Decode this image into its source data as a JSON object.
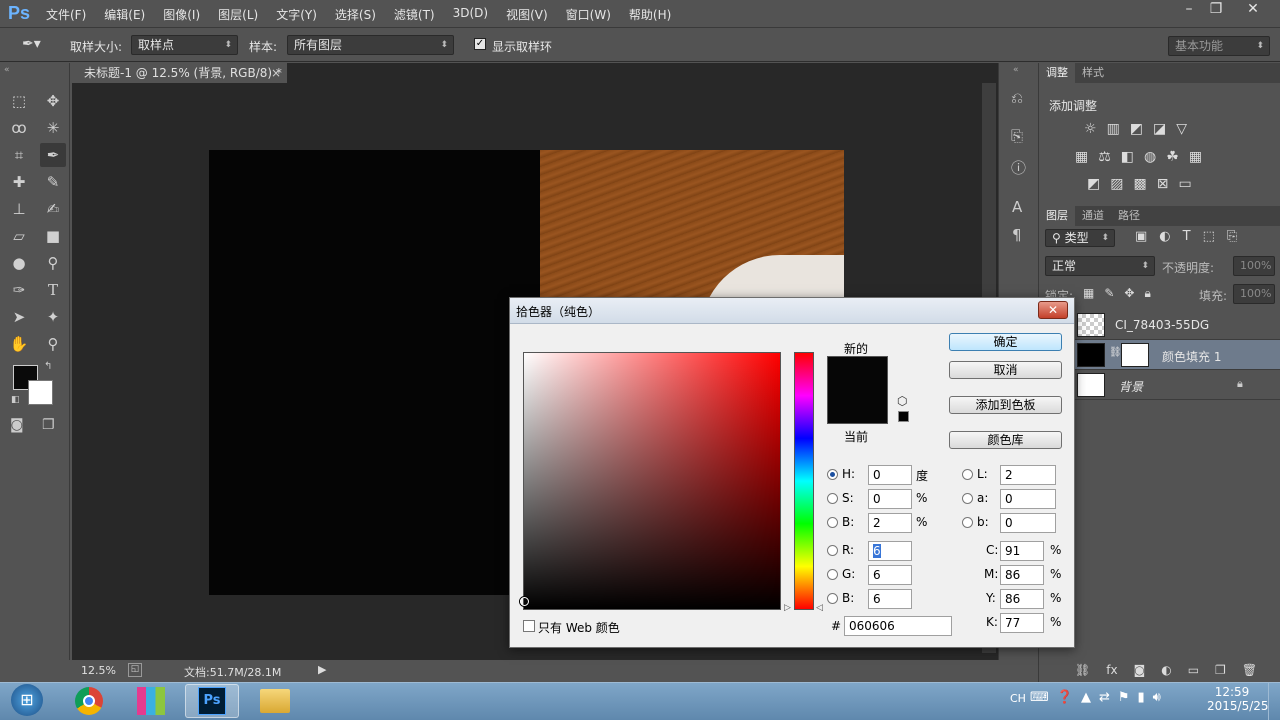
{
  "app": {
    "logo": "Ps"
  },
  "menu": [
    "文件(F)",
    "编辑(E)",
    "图像(I)",
    "图层(L)",
    "文字(Y)",
    "选择(S)",
    "滤镜(T)",
    "3D(D)",
    "视图(V)",
    "窗口(W)",
    "帮助(H)"
  ],
  "options": {
    "sample_size_label": "取样大小:",
    "sample_size_value": "取样点",
    "sample_label": "样本:",
    "sample_value": "所有图层",
    "show_ring_label": "显示取样环",
    "workspace": "基本功能"
  },
  "document": {
    "tab_title": "未标题-1 @ 12.5% (背景, RGB/8) *",
    "zoom": "12.5%",
    "doc_info": "文档:51.7M/28.1M"
  },
  "adjust_panel": {
    "tab_adjust": "调整",
    "tab_style": "样式",
    "title": "添加调整"
  },
  "layers_panel": {
    "tab_layers": "图层",
    "tab_channels": "通道",
    "tab_paths": "路径",
    "filter_kind": "类型",
    "blend_mode": "正常",
    "opacity_label": "不透明度:",
    "opacity_value": "100%",
    "lock_label": "锁定:",
    "fill_label": "填充:",
    "fill_value": "100%",
    "layers": [
      {
        "name": "CI_78403-55DG"
      },
      {
        "name": "颜色填充 1"
      },
      {
        "name": "背景"
      }
    ]
  },
  "dialog": {
    "title": "拾色器（纯色）",
    "new_label": "新的",
    "current_label": "当前",
    "new_color": "#060606",
    "current_color": "#060606",
    "btn_ok": "确定",
    "btn_cancel": "取消",
    "btn_add_swatch": "添加到色板",
    "btn_library": "颜色库",
    "web_only_label": "只有 Web 颜色",
    "hsb": {
      "H": "0",
      "H_unit": "度",
      "S": "0",
      "S_unit": "%",
      "B": "2",
      "B_unit": "%"
    },
    "lab": {
      "L": "2",
      "a": "0",
      "b": "0"
    },
    "rgb": {
      "R": "6",
      "G": "6",
      "B": "6"
    },
    "cmyk": {
      "C": "91",
      "M": "86",
      "Y": "86",
      "K": "77",
      "unit": "%"
    },
    "hex": "060606",
    "labels": {
      "H": "H:",
      "S": "S:",
      "B": "B:",
      "L": "L:",
      "a": "a:",
      "b": "b:",
      "R": "R:",
      "G": "G:",
      "Bb": "B:",
      "C": "C:",
      "M": "M:",
      "Y": "Y:",
      "K": "K:",
      "hash": "#"
    }
  },
  "taskbar": {
    "lang": "CH",
    "time": "12:59",
    "date": "2015/5/25"
  }
}
